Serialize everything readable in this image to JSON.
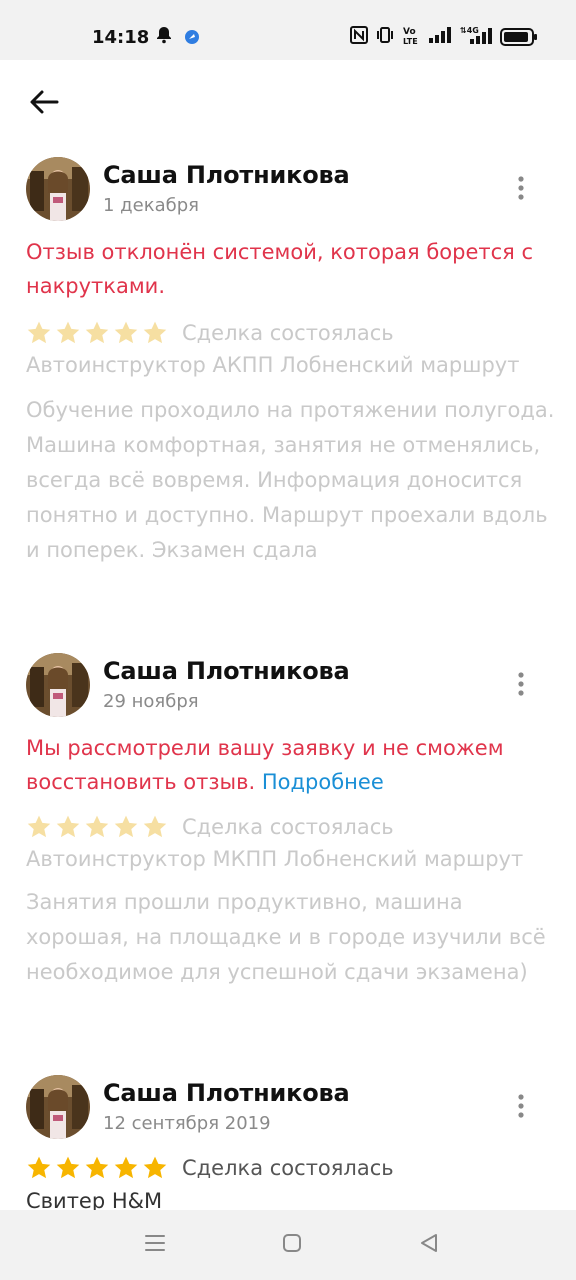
{
  "status_bar": {
    "time": "14:18"
  },
  "reviews": [
    {
      "author": "Саша Плотникова",
      "date": "1 декабря",
      "notice": "Отзыв отклонён системой, которая борется с накрутками.",
      "rating": 5,
      "deal": "Сделка состоялась",
      "product": "Автоинструктор АКПП Лобненский маршрут",
      "text": "Обучение проходило на протяжении полугода. Машина комфортная, занятия не отменялись, всегда всё вовремя. Информация доносится понятно и доступно. Маршрут проехали вдоль и поперек. Экзамен сдала"
    },
    {
      "author": "Саша Плотникова",
      "date": "29 ноября",
      "notice": "Мы рассмотрели вашу заявку и не сможем восстановить отзыв.",
      "notice_link": "Подробнее",
      "rating": 5,
      "deal": "Сделка состоялась",
      "product": "Автоинструктор МКПП Лобненский маршрут",
      "text": "Занятия прошли продуктивно, машина хорошая, на площадке и в городе изучили всё необходимое для успешной сдачи экзамена)"
    },
    {
      "author": "Саша Плотникова",
      "date": "12 сентября 2019",
      "rating": 5,
      "deal": "Сделка состоялась",
      "product": "Свитер H&M"
    }
  ],
  "colors": {
    "notice_red": "#e0344b",
    "link_blue": "#1a8fd6",
    "star_faded": "#f6dfa2",
    "star_active": "#f7b500"
  },
  "icons": {
    "back": "arrow-left-icon",
    "more": "more-vertical-icon",
    "nav_menu": "menu-icon",
    "nav_home": "square-icon",
    "nav_back": "triangle-back-icon"
  }
}
